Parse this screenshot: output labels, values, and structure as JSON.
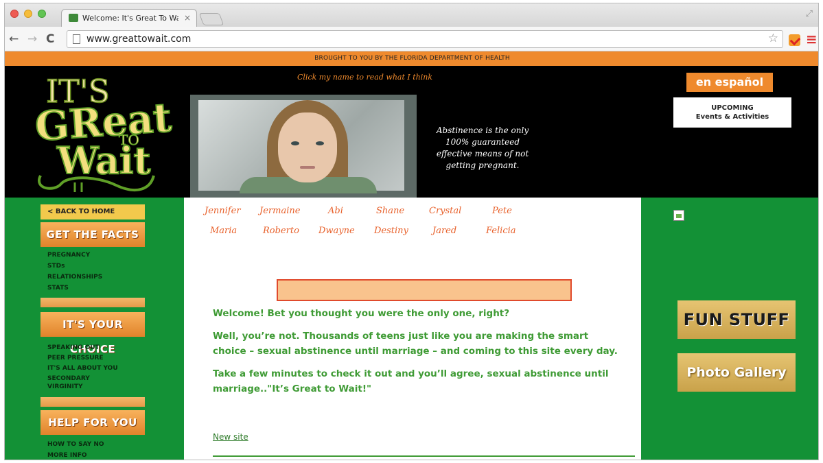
{
  "browser": {
    "tab_title": "Welcome: It's Great To Wa",
    "tab_close": "×",
    "url": "www.greattowait.com",
    "back_icon": "←",
    "forward_icon": "→",
    "reload_icon": "C",
    "star_icon": "☆",
    "menu_icon": "≡",
    "resize_icon": "⤢"
  },
  "topbar": {
    "text": "BROUGHT TO YOU BY THE FLORIDA DEPARTMENT OF HEALTH"
  },
  "header": {
    "logo": {
      "its": "IT'S",
      "great": "GReat",
      "to": "TO",
      "wait": "Wait"
    },
    "tagline": "Click my name to read what I think",
    "quote": "Abstinence is the only 100% guaranteed effective means of not getting pregnant.",
    "espanol": "en español",
    "upcoming_line1": "UPCOMING",
    "upcoming_line2": "Events & Activities"
  },
  "left_nav": {
    "back_home": "< BACK TO HOME",
    "get_the_facts": "GET THE FACTS",
    "facts_items": [
      "PREGNANCY",
      "STDs",
      "RELATIONSHIPS",
      "STATS"
    ],
    "its_your_choice": "IT'S YOUR CHOICE",
    "choice_items": [
      "SPEAKING OUT",
      "PEER PRESSURE",
      "IT'S ALL ABOUT YOU",
      "SECONDARY",
      "VIRGINITY"
    ],
    "help_for_you": "HELP FOR YOU",
    "help_items": [
      "HOW TO SAY NO",
      "MORE INFO"
    ]
  },
  "names": {
    "row1": [
      "Jennifer",
      "Jermaine",
      "Abi",
      "Shane",
      "Crystal",
      "Pete"
    ],
    "row2": [
      "Maria",
      "Roberto",
      "Dwayne",
      "Destiny",
      "Jared",
      "Felicia"
    ]
  },
  "main": {
    "para1": "Welcome! Bet you thought you were the only one, right?",
    "para2": "Well, you’re not. Thousands of teens just like you are making the smart choice – sexual abstinence until marriage – and coming to this site every day.",
    "para3": "Take a few minutes to check it out and you’ll agree, sexual abstinence until marriage..\"It’s Great to Wait!\"",
    "new_site": "New site"
  },
  "right_nav": {
    "fun_stuff": "FUN STUFF",
    "photo_gallery": "Photo Gallery"
  },
  "colors": {
    "orange": "#ef8a2d",
    "green": "#139136",
    "text_green": "#3f9b35",
    "name_orange": "#e8602a"
  }
}
